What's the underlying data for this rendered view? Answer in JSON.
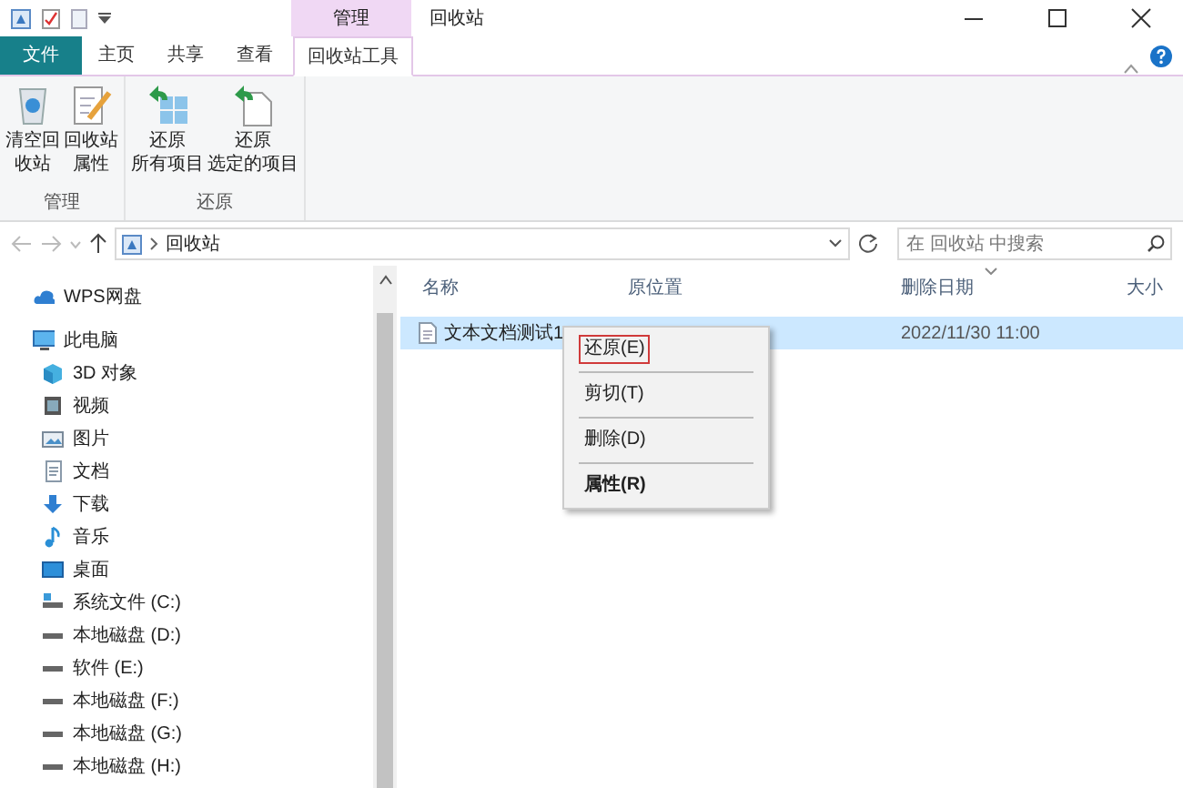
{
  "title_bar": {
    "context_group": "管理",
    "title": "回收站"
  },
  "tabs": [
    {
      "label": "文件",
      "kind": "file",
      "selected": false
    },
    {
      "label": "主页",
      "kind": "normal",
      "selected": false
    },
    {
      "label": "共享",
      "kind": "normal",
      "selected": false
    },
    {
      "label": "查看",
      "kind": "normal",
      "selected": false
    },
    {
      "label": "回收站工具",
      "kind": "normal",
      "selected": true
    }
  ],
  "ribbon": [
    {
      "label": "管理",
      "buttons": [
        {
          "kind": "bin",
          "lines": [
            "清空回",
            "收站"
          ]
        },
        {
          "kind": "props",
          "lines": [
            "回收站",
            "属性"
          ]
        }
      ]
    },
    {
      "label": "还原",
      "buttons": [
        {
          "kind": "restore-all",
          "lines": [
            "还原",
            "所有项目"
          ]
        },
        {
          "kind": "restore-one",
          "lines": [
            "还原",
            "选定的项目"
          ]
        }
      ]
    }
  ],
  "address": {
    "path": "回收站",
    "search_placeholder": "在 回收站 中搜索"
  },
  "nav": [
    {
      "label": "WPS网盘",
      "kind": "cloud"
    },
    {
      "label": "此电脑",
      "kind": "pc",
      "children": [
        {
          "label": "3D 对象",
          "kind": "cube"
        },
        {
          "label": "视频",
          "kind": "video"
        },
        {
          "label": "图片",
          "kind": "picture"
        },
        {
          "label": "文档",
          "kind": "doc"
        },
        {
          "label": "下载",
          "kind": "download"
        },
        {
          "label": "音乐",
          "kind": "music"
        },
        {
          "label": "桌面",
          "kind": "desktop"
        },
        {
          "label": "系统文件 (C:)",
          "kind": "sysdrive"
        },
        {
          "label": "本地磁盘 (D:)",
          "kind": "drive"
        },
        {
          "label": "软件 (E:)",
          "kind": "drive"
        },
        {
          "label": "本地磁盘 (F:)",
          "kind": "drive"
        },
        {
          "label": "本地磁盘 (G:)",
          "kind": "drive"
        },
        {
          "label": "本地磁盘 (H:)",
          "kind": "drive"
        }
      ]
    }
  ],
  "table": {
    "columns": [
      {
        "label": "名称",
        "sorted": false
      },
      {
        "label": "原位置",
        "sorted": false
      },
      {
        "label": "删除日期",
        "sorted": true
      },
      {
        "label": "大小",
        "sorted": false
      }
    ],
    "rows": [
      {
        "name": "文本文档测试1",
        "deleted": "2022/11/30 11:00",
        "selected": true
      }
    ]
  },
  "context_menu": [
    {
      "label": "还原(E)",
      "outlined": true,
      "default": false
    },
    {
      "label": "剪切(T)",
      "outlined": false,
      "default": false
    },
    {
      "label": "删除(D)",
      "outlined": false,
      "default": false
    },
    {
      "label": "属性(R)",
      "outlined": false,
      "default": true
    }
  ]
}
